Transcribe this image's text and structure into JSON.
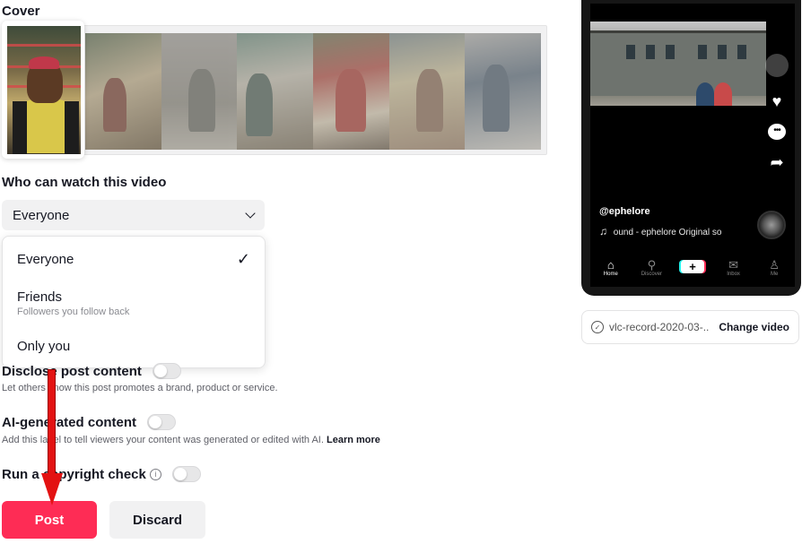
{
  "cover": {
    "label": "Cover"
  },
  "privacy": {
    "label": "Who can watch this video",
    "selected": "Everyone",
    "options": [
      {
        "label": "Everyone",
        "sub": "",
        "checked": true
      },
      {
        "label": "Friends",
        "sub": "Followers you follow back",
        "checked": false
      },
      {
        "label": "Only you",
        "sub": "",
        "checked": false
      }
    ],
    "check_glyph": "✓"
  },
  "disclose": {
    "title": "Disclose post content",
    "desc": "Let others know this post promotes a brand, product or service.",
    "enabled": false
  },
  "ai": {
    "title": "AI-generated content",
    "desc": "Add this label to tell viewers your content was generated or edited with AI.",
    "learn_more": "Learn more",
    "enabled": false
  },
  "copyright": {
    "title": "Run a copyright check",
    "info_glyph": "i",
    "enabled": false
  },
  "buttons": {
    "post": "Post",
    "discard": "Discard"
  },
  "preview": {
    "username": "@ephelore",
    "sound": "ound - ephelore Original so",
    "sound_icon": "♫",
    "tabs": [
      {
        "label": "Home",
        "icon": "home-icon",
        "glyph": "⌂",
        "active": true
      },
      {
        "label": "Discover",
        "icon": "search-icon",
        "glyph": "⚲",
        "active": false
      },
      {
        "label": "",
        "icon": "plus-icon",
        "glyph": "+",
        "active": false
      },
      {
        "label": "Inbox",
        "icon": "inbox-icon",
        "glyph": "✉",
        "active": false
      },
      {
        "label": "Me",
        "icon": "profile-icon",
        "glyph": "♙",
        "active": false
      }
    ],
    "side_icons": {
      "heart": "♥",
      "comment": "•••",
      "share": "➦"
    }
  },
  "video_file": {
    "name": "vlc-record-2020-03-...",
    "change_label": "Change video"
  },
  "colors": {
    "accent": "#fe2c55",
    "annotation_arrow": "#e31212"
  }
}
